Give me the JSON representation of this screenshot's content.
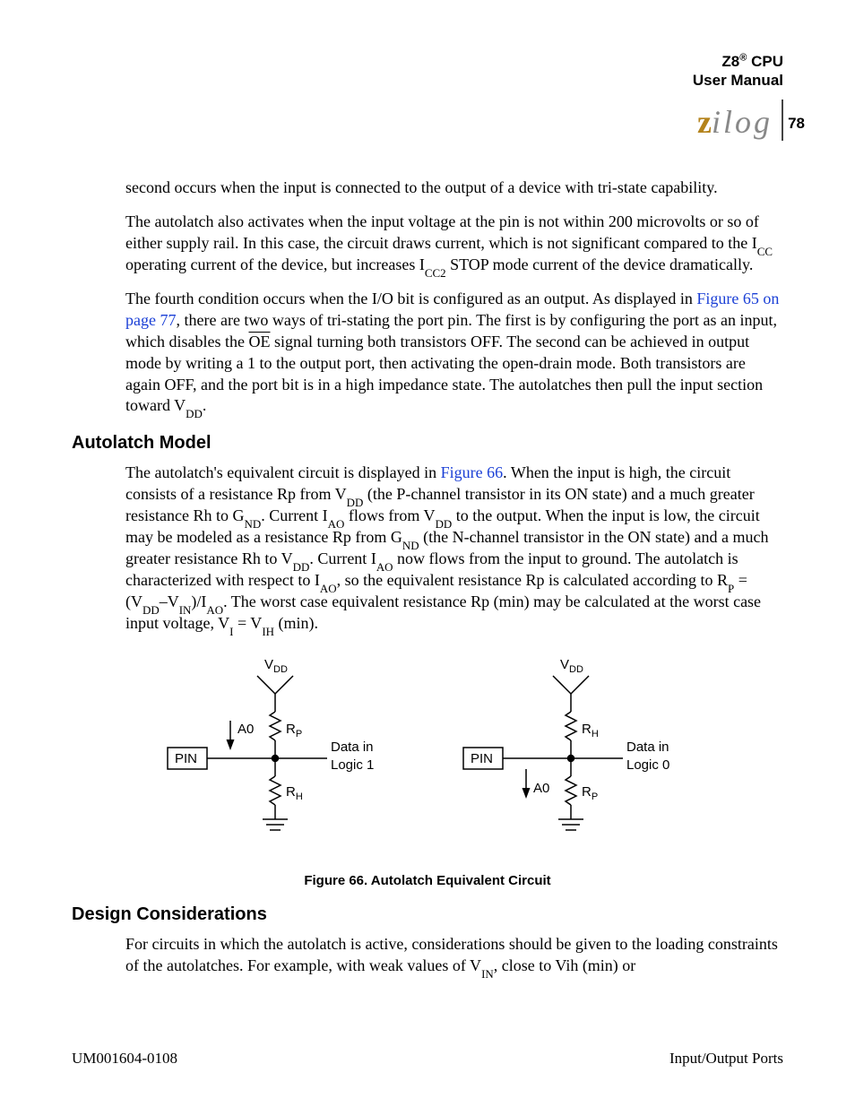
{
  "header": {
    "product_sup": "®",
    "product": "Z8",
    "product_suffix": " CPU",
    "subtitle": "User Manual",
    "logo_text": "zilog",
    "page_number": "78"
  },
  "body": {
    "p1": "second occurs when the input is connected to the output of a device with tri-state capability.",
    "p2_a": "The autolatch also activates when the input voltage at the pin is not within 200 microvolts or so of either supply rail. In this case, the circuit draws current, which is not significant compared to the I",
    "p2_sub1": "CC",
    "p2_b": " operating current of the device, but increases I",
    "p2_sub2": "CC2",
    "p2_c": " STOP mode current of the device dramatically.",
    "p3_a": "The fourth condition occurs when the I/O bit is configured as an output. As displayed in ",
    "p3_link": "Figure 65 on page 77",
    "p3_b": ", there are two ways of tri-stating the port pin. The first is by configuring the port as an input, which disables the ",
    "p3_over": "OE",
    "p3_c": " signal turning both transistors OFF. The second can be achieved in output mode by writing a 1 to the output port, then activating the open-drain mode. Both transistors are again OFF, and the port bit is in a high impedance state. The autolatches then pull the input section toward V",
    "p3_sub": "DD",
    "p3_d": ".",
    "h_autolatch": "Autolatch Model",
    "p4_a": "The autolatch's equivalent circuit is displayed in ",
    "p4_link": "Figure 66",
    "p4_b": ". When the input is high, the circuit consists of a resistance Rp from V",
    "p4_s1": "DD",
    "p4_c": " (the P-channel transistor in its ON state) and a much greater resistance Rh to G",
    "p4_s2": "ND",
    "p4_d": ". Current I",
    "p4_s3": "AO",
    "p4_e": " flows from V",
    "p4_s4": "DD",
    "p4_f": " to the output. When the input is low, the circuit may be modeled as a resistance Rp from G",
    "p4_s5": "ND",
    "p4_g": " (the N-channel transistor in the ON state) and a much greater resistance Rh to V",
    "p4_s6": "DD",
    "p4_h": ". Current I",
    "p4_s7": "AO",
    "p4_i": " now flows from the input to ground. The autolatch is characterized with respect to I",
    "p4_s8": "AO",
    "p4_j": ", so the equivalent resistance Rp is calculated according to R",
    "p4_s9": "P",
    "p4_k": " = (V",
    "p4_s10": "DD",
    "p4_l": "–V",
    "p4_s11": "IN",
    "p4_m": ")/I",
    "p4_s12": "AO",
    "p4_n": ". The worst case equivalent resistance Rp (min) may be calculated at the worst case input voltage, V",
    "p4_s13": "I",
    "p4_o": " = V",
    "p4_s14": "IH",
    "p4_p": " (min).",
    "fig_caption": "Figure 66. Autolatch Equivalent Circuit",
    "h_design": "Design Considerations",
    "p5_a": "For circuits in which the autolatch is active, considerations should be given to the loading constraints of the autolatches. For example, with weak values of V",
    "p5_s1": "IN",
    "p5_b": ", close to Vih (min) or"
  },
  "figure": {
    "vdd": "V",
    "vdd_sub": "DD",
    "pin": "PIN",
    "a0": "A0",
    "rp": "R",
    "rp_sub": "P",
    "rh": "R",
    "rh_sub": "H",
    "data_in": "Data in",
    "logic1": "Logic 1",
    "logic0": "Logic 0"
  },
  "footer": {
    "left": "UM001604-0108",
    "right": "Input/Output Ports"
  }
}
